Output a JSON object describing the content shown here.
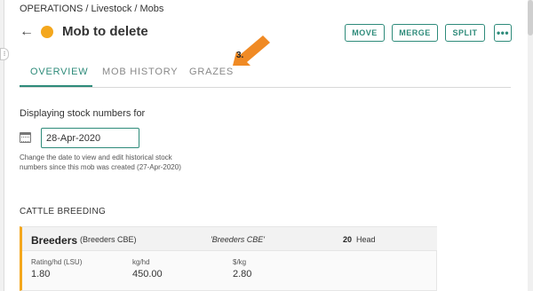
{
  "breadcrumb": "OPERATIONS / Livestock / Mobs",
  "header": {
    "title": "Mob to delete",
    "back_icon": "←",
    "status_color": "#f4a71d",
    "buttons": {
      "move": "MOVE",
      "merge": "MERGE",
      "split": "SPLIT",
      "more": "•••"
    }
  },
  "tabs": [
    {
      "label": "OVERVIEW",
      "active": true
    },
    {
      "label": "MOB HISTORY",
      "active": false
    },
    {
      "label": "GRAZES",
      "active": false
    }
  ],
  "annotation": {
    "label": "3.",
    "color": "#f08a24"
  },
  "stock": {
    "label": "Displaying stock numbers for",
    "date": "28-Apr-2020",
    "help": "Change the date to view and edit historical stock numbers since this mob was created (27-Apr-2020)"
  },
  "category": "CATTLE BREEDING",
  "mob_card": {
    "name": "Breeders",
    "subname": "(Breeders CBE)",
    "alias": "'Breeders CBE'",
    "head_count": "20",
    "head_label": "Head",
    "stats": [
      {
        "label": "Rating/hd (LSU)",
        "value": "1.80"
      },
      {
        "label": "kg/hd",
        "value": "450.00"
      },
      {
        "label": "$/kg",
        "value": "2.80"
      }
    ]
  },
  "colors": {
    "accent": "#2e8b7a",
    "status": "#f4a71d",
    "annotation": "#f08a24"
  },
  "icons": {
    "sidebar_toggle": "⁝",
    "calendar": "calendar-icon"
  }
}
